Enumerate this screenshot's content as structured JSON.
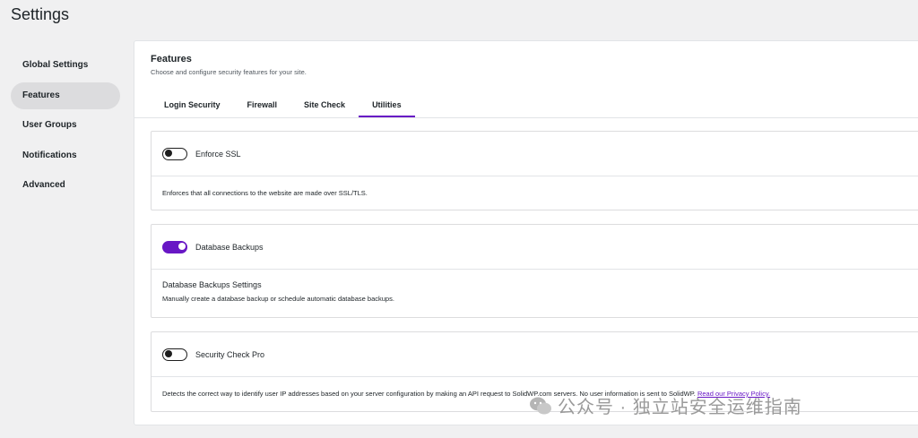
{
  "page": {
    "title": "Settings"
  },
  "sidebar": {
    "items": [
      {
        "label": "Global Settings"
      },
      {
        "label": "Features"
      },
      {
        "label": "User Groups"
      },
      {
        "label": "Notifications"
      },
      {
        "label": "Advanced"
      }
    ],
    "active": "Features"
  },
  "features": {
    "title": "Features",
    "subtitle": "Choose and configure security features for your site.",
    "tabs": [
      {
        "label": "Login Security"
      },
      {
        "label": "Firewall"
      },
      {
        "label": "Site Check"
      },
      {
        "label": "Utilities"
      }
    ],
    "active_tab": "Utilities"
  },
  "cards": {
    "enforce_ssl": {
      "label": "Enforce SSL",
      "enabled": false,
      "description": "Enforces that all connections to the website are made over SSL/TLS."
    },
    "database_backups": {
      "label": "Database Backups",
      "enabled": true,
      "settings_title": "Database Backups Settings",
      "description": "Manually create a database backup or schedule automatic database backups."
    },
    "security_check_pro": {
      "label": "Security Check Pro",
      "enabled": false,
      "description": "Detects the correct way to identify user IP addresses based on your server configuration by making an API request to SolidWP.com servers. No user information is sent to SolidWP.",
      "link_text": "Read our Privacy Policy."
    }
  },
  "watermark": {
    "text": "公众号 · 独立站安全运维指南"
  },
  "colors": {
    "accent": "#6817c5",
    "background": "#f0f0f1",
    "panel": "#ffffff"
  }
}
